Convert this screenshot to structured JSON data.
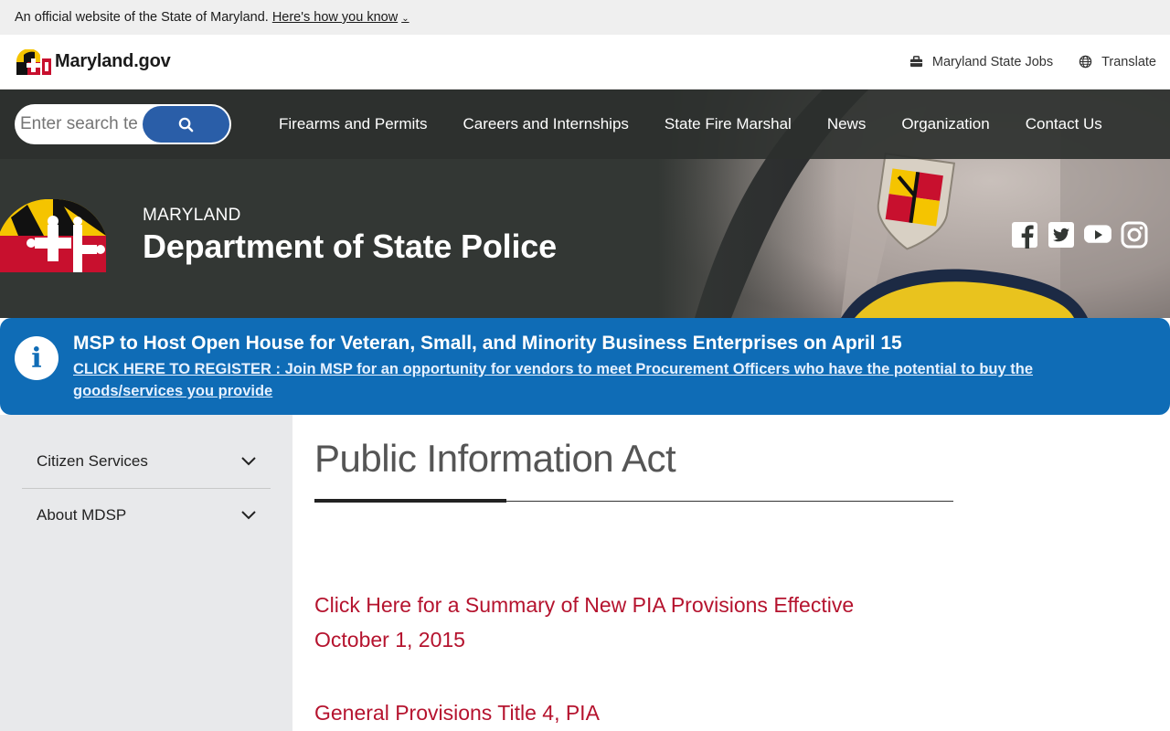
{
  "gov_banner": {
    "text": "An official website of the State of Maryland.",
    "how_link": "Here's how you know",
    "chevron": "⌄"
  },
  "header": {
    "brand": "Maryland.gov",
    "jobs_label": "Maryland State Jobs",
    "jobs_icon": "briefcase-icon",
    "translate_label": "Translate",
    "translate_icon": "globe-icon"
  },
  "search": {
    "placeholder": "Enter search terms"
  },
  "nav": {
    "items": [
      "Firearms and Permits",
      "Careers and Internships",
      "State Fire Marshal",
      "News",
      "Organization",
      "Contact Us"
    ]
  },
  "agency": {
    "small": "MARYLAND",
    "title": "Department of State Police"
  },
  "socials": [
    "facebook-icon",
    "twitter-icon",
    "youtube-icon",
    "instagram-icon"
  ],
  "alert": {
    "title": "MSP to Host Open House for Veteran, Small, and Minority Business Enterprises on April 15",
    "link": "CLICK HERE TO REGISTER : Join MSP for an opportunity for vendors to meet Procurement Officers who have the potential to buy the goods/services you provide",
    "background": "#0f6cb6"
  },
  "sidebar": {
    "items": [
      "Citizen Services",
      "About MDSP"
    ]
  },
  "main": {
    "title": "Public Information Act",
    "links": [
      "Click Here for a Summary of New PIA Provisions Effective October 1, 2015",
      "General Provisions Title 4, PIA"
    ],
    "link_color": "#b5132e"
  }
}
